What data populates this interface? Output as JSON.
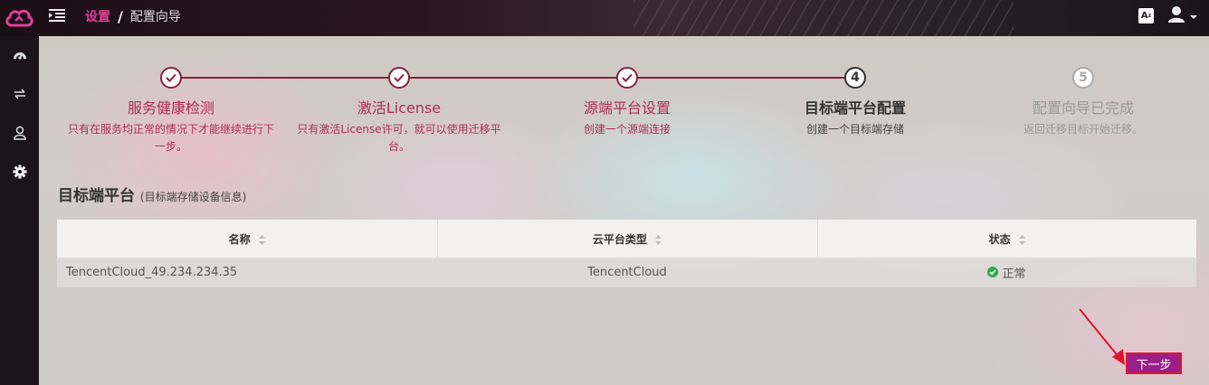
{
  "header": {
    "breadcrumb": {
      "root": "设置",
      "separator": "/",
      "current": "配置向导"
    },
    "lang_label": "A"
  },
  "sidebar": {
    "items": [
      {
        "name": "dashboard",
        "icon": "dashboard-icon"
      },
      {
        "name": "migration",
        "icon": "transfer-icon"
      },
      {
        "name": "user",
        "icon": "user-icon"
      },
      {
        "name": "settings",
        "icon": "gear-icon"
      }
    ]
  },
  "steps": [
    {
      "number": "1",
      "title": "服务健康检测",
      "desc": "只有在服务均正常的情况下才能继续进行下一步。",
      "state": "done"
    },
    {
      "number": "2",
      "title": "激活License",
      "desc": "只有激活License许可，就可以使用迁移平台。",
      "state": "done"
    },
    {
      "number": "3",
      "title": "源端平台设置",
      "desc": "创建一个源端连接",
      "state": "done"
    },
    {
      "number": "4",
      "title": "目标端平台配置",
      "desc": "创建一个目标端存储",
      "state": "active"
    },
    {
      "number": "5",
      "title": "配置向导已完成",
      "desc": "返回迁移目标开始迁移。",
      "state": "todo"
    }
  ],
  "section": {
    "title": "目标端平台",
    "subtitle": "(目标端存储设备信息)"
  },
  "table": {
    "columns": [
      "名称",
      "云平台类型",
      "状态"
    ],
    "rows": [
      {
        "name": "TencentCloud_49.234.234.35",
        "platform": "TencentCloud",
        "status": "正常"
      }
    ]
  },
  "actions": {
    "next_label": "下一步"
  },
  "colors": {
    "accent": "#9b1f8a",
    "brand_pink": "#e0409a",
    "step_done": "#8a2040",
    "status_ok": "#2eaa4a"
  }
}
